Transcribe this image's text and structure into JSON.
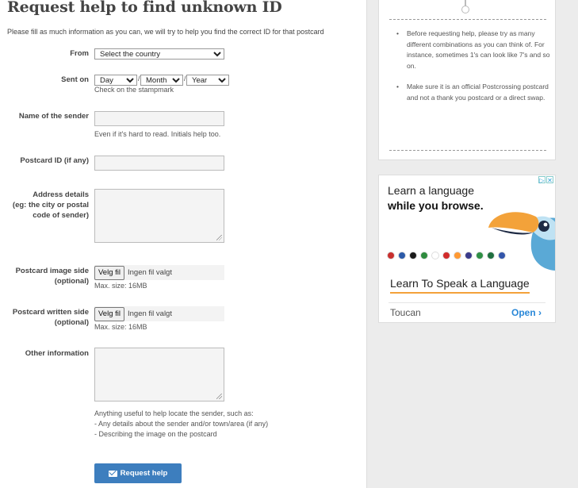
{
  "page": {
    "title": "Request help to find unknown ID",
    "intro": "Please fill as much information as you can, we will try to help you find the correct ID for that postcard"
  },
  "form": {
    "from": {
      "label": "From",
      "selected": "Select the country"
    },
    "sent_on": {
      "label": "Sent on",
      "day": "Day",
      "month": "Month",
      "year": "Year",
      "separator": "/",
      "hint": "Check on the stampmark"
    },
    "sender": {
      "label": "Name of the sender",
      "value": "",
      "hint": "Even if it's hard to read. Initials help too."
    },
    "postcard_id": {
      "label": "Postcard ID (if any)",
      "value": ""
    },
    "address": {
      "label_lines": [
        "Address details",
        "(eg: the city or postal",
        "code of sender)"
      ],
      "value": ""
    },
    "image_side": {
      "label_lines": [
        "Postcard image side",
        "(optional)"
      ],
      "button": "Velg fil",
      "status": "Ingen fil valgt",
      "hint": "Max. size: 16MB"
    },
    "written_side": {
      "label_lines": [
        "Postcard written side",
        "(optional)"
      ],
      "button": "Velg fil",
      "status": "Ingen fil valgt",
      "hint": "Max. size: 16MB"
    },
    "other": {
      "label": "Other information",
      "value": "",
      "hint_lines": [
        "Anything useful to help locate the sender, such as:",
        "- Any details about the sender and/or town/area (if any)",
        "- Describing the image on the postcard"
      ]
    },
    "submit_label": "Request help",
    "submit_icon": "envelope-icon"
  },
  "sidebar": {
    "tips": [
      "Before requesting help, please try as many different combinations as you can think of. For instance, sometimes 1's can look like 7's and so on.",
      "Make sure it is an official Postcrossing postcard and not a thank you postcard or a direct swap."
    ]
  },
  "ad": {
    "headline_1": "Learn a language",
    "headline_2": "while you browse.",
    "cta": "Learn To Speak a Language",
    "brand": "Toucan",
    "open_label": "Open",
    "open_chevron": "›",
    "adchoices_icons": [
      "adchoices-icon",
      "close-icon"
    ],
    "flag_colors": [
      "#c8302f",
      "#2b5aa8",
      "#1b1b1b",
      "#2e8b3e",
      "#ffffff",
      "#d12b2b",
      "#ff9933",
      "#3a3a8a",
      "#2f8f45",
      "#1f6f3f",
      "#3355aa"
    ],
    "colors": {
      "cta_underline": "#f3a23a",
      "open_link": "#2a88d8",
      "beak": "#f3a23a",
      "bird_body": "#5aa9d6"
    }
  },
  "colors": {
    "submit_bg": "#3d7ebe",
    "sidebar_bg": "#ececec"
  }
}
